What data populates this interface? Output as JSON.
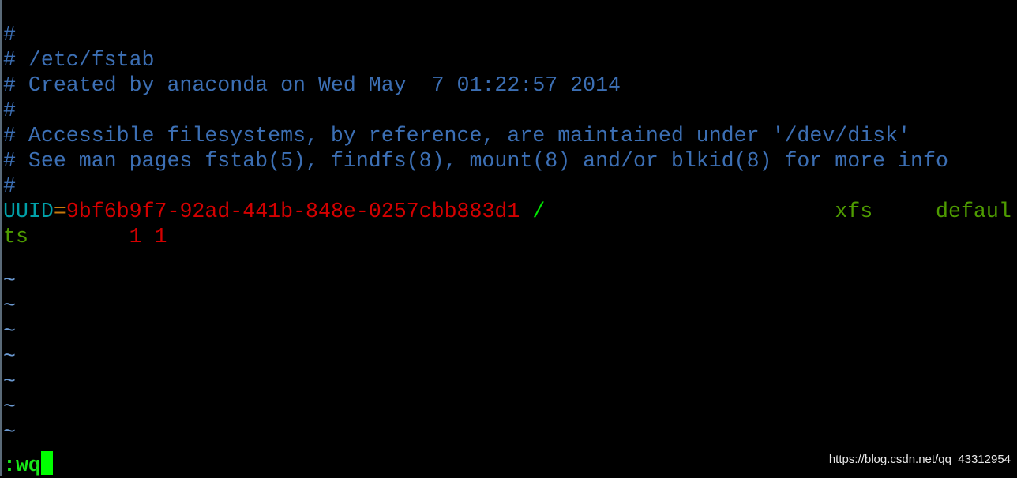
{
  "editor": "vim",
  "file_lines": {
    "l1": "#",
    "l2": "# /etc/fstab",
    "l3": "# Created by anaconda on Wed May  7 01:22:57 2014",
    "l4": "#",
    "l5": "# Accessible filesystems, by reference, are maintained under '/dev/disk'",
    "l6": "# See man pages fstab(5), findfs(8), mount(8) and/or blkid(8) for more info",
    "l7": "#",
    "entry": {
      "key": "UUID",
      "eq": "=",
      "uuid": "9bf6b9f7-92ad-441b-848e-0257cbb883d1",
      "mount": "/",
      "gap1": "                       ",
      "fstype": "xfs",
      "gap2": "     ",
      "options_part1": "defaul",
      "options_part2": "ts",
      "gap3": "        ",
      "dump_pass": "1 1"
    }
  },
  "tilde": "~",
  "command_line": ":wq",
  "watermark": "https://blog.csdn.net/qq_43312954",
  "colors": {
    "comment": "#3c6fb4",
    "keyword": "#00a0a8",
    "value": "#d40000",
    "fs": "#4e9c00",
    "cursor": "#00ff00"
  }
}
